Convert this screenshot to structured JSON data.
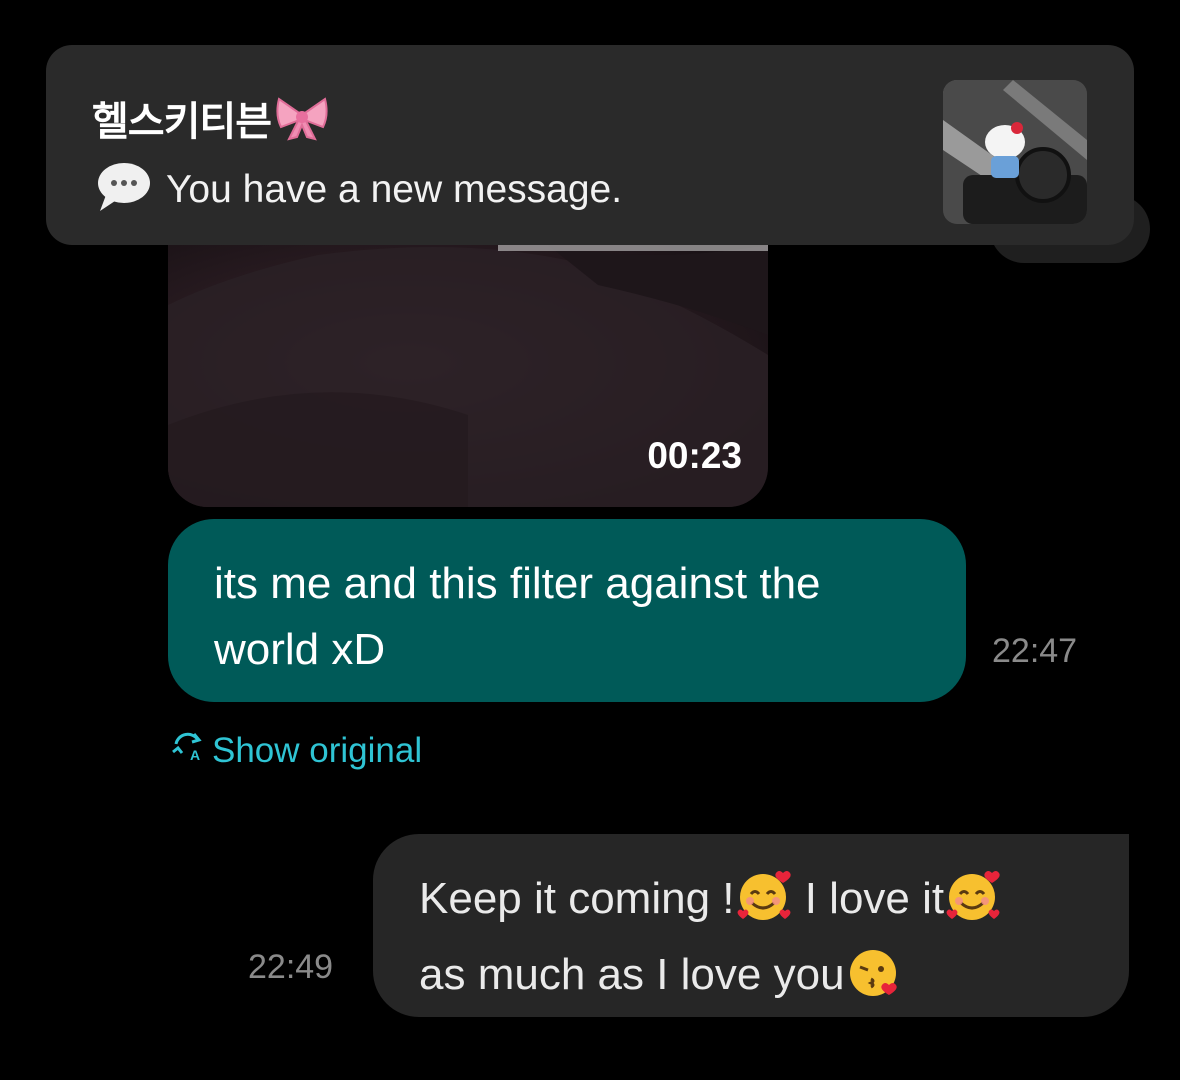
{
  "notification": {
    "sender": "헬스키티븐",
    "message": "You have a new message.",
    "chat_icon": "speech-bubble-icon",
    "bow_icon": "ribbon-bow-icon",
    "thumbnail": "hello-kitty-gym-photo"
  },
  "video": {
    "duration": "00:23"
  },
  "messages": [
    {
      "direction": "sent",
      "text": "its me and this filter against the world xD",
      "time": "22:47",
      "translation_action": "Show original",
      "translate_icon": "translate-icon"
    },
    {
      "direction": "received",
      "text_parts": [
        "Keep it coming !",
        " I love it",
        "as much as I love you"
      ],
      "emojis": [
        "smiling-face-with-hearts-icon",
        "smiling-face-with-hearts-icon",
        "face-blowing-kiss-icon"
      ],
      "time": "22:49"
    }
  ],
  "colors": {
    "background": "#000000",
    "banner": "#2a2a2a",
    "sent_bubble": "#005a58",
    "received_bubble": "#262626",
    "link": "#2fc4d4",
    "timestamp": "#8a8a8a"
  }
}
